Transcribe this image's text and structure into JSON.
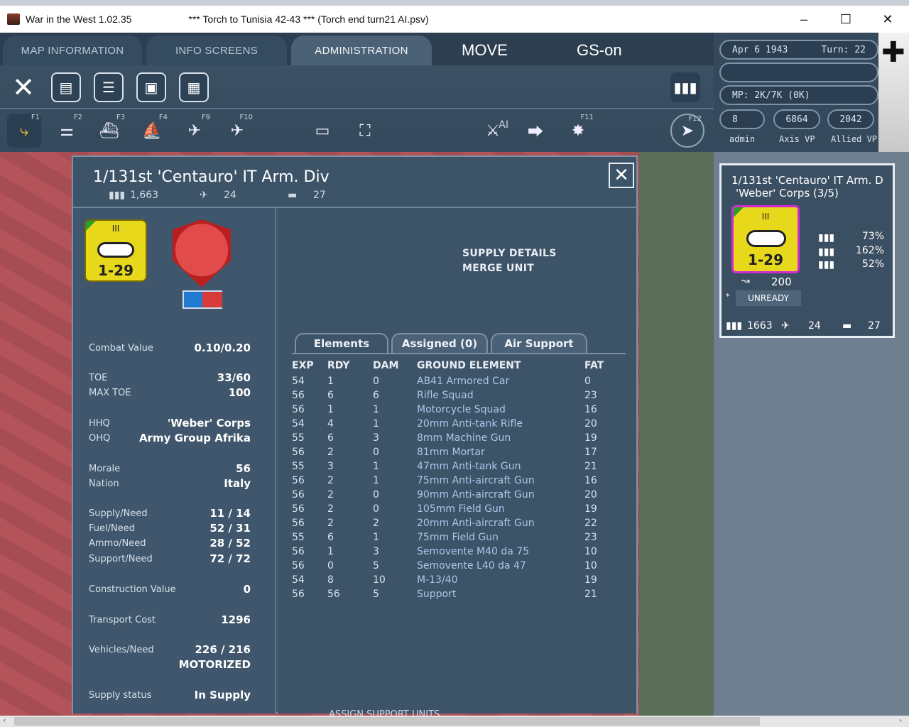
{
  "window": {
    "app_title": "War in the West  1.02.35",
    "scenario": "***   Torch to Tunisia 42-43   ***   (Torch end turn21 AI.psv)"
  },
  "tabs": [
    "MAP INFORMATION",
    "INFO SCREENS",
    "ADMINISTRATION"
  ],
  "mode": {
    "move": "MOVE",
    "gs": "GS-on"
  },
  "fkeys": [
    "F1",
    "F2",
    "F3",
    "F4",
    "F9",
    "F10",
    "F11",
    "F12"
  ],
  "toolbar_ai": "AI",
  "status": {
    "date": "Apr 6 1943",
    "turn": "Turn: 22",
    "mp": "MP:  2K/7K (0K)",
    "admin_val": "8",
    "axis_vp": "6864",
    "allied_vp": "2042",
    "admin_label": "admin",
    "axis_label": "Axis VP",
    "allied_label": "Allied VP"
  },
  "unit": {
    "title": "1/131st 'Centauro' IT Arm. Div",
    "men": "1,663",
    "guns": "24",
    "afv": "27",
    "counter_size": "III",
    "counter_value": "1-29",
    "fields": [
      {
        "label": "Combat Value",
        "value": "0.10/0.20"
      },
      {
        "label": "TOE",
        "value": "33/60"
      },
      {
        "label": "MAX TOE",
        "value": "100"
      },
      {
        "label": "HHQ",
        "value": "'Weber' Corps"
      },
      {
        "label": "OHQ",
        "value": "Army Group Afrika"
      },
      {
        "label": "Morale",
        "value": "56"
      },
      {
        "label": "Nation",
        "value": "Italy"
      },
      {
        "label": "Supply/Need",
        "value": "11 / 14"
      },
      {
        "label": "Fuel/Need",
        "value": "52 / 31"
      },
      {
        "label": "Ammo/Need",
        "value": "28 / 52"
      },
      {
        "label": "Support/Need",
        "value": "72 / 72"
      },
      {
        "label": "Construction Value",
        "value": "0"
      },
      {
        "label": "Transport Cost",
        "value": "1296"
      },
      {
        "label": "Vehicles/Need",
        "value": "226 / 216"
      },
      {
        "label": "",
        "value": "MOTORIZED"
      },
      {
        "label": "Supply status",
        "value": "In Supply"
      }
    ],
    "links": [
      "SUPPLY DETAILS",
      "MERGE UNIT"
    ],
    "subtabs": [
      "Elements",
      "Assigned (0)",
      "Air Support"
    ],
    "headers": [
      "EXP",
      "RDY",
      "DAM",
      "GROUND ELEMENT",
      "FAT"
    ],
    "elements": [
      [
        "54",
        "1",
        "0",
        "AB41 Armored Car",
        "0"
      ],
      [
        "56",
        "6",
        "6",
        "Rifle Squad",
        "23"
      ],
      [
        "56",
        "1",
        "1",
        "Motorcycle Squad",
        "16"
      ],
      [
        "54",
        "4",
        "1",
        "20mm Anti-tank Rifle",
        "20"
      ],
      [
        "55",
        "6",
        "3",
        "8mm Machine Gun",
        "19"
      ],
      [
        "56",
        "2",
        "0",
        "81mm Mortar",
        "17"
      ],
      [
        "55",
        "3",
        "1",
        "47mm Anti-tank Gun",
        "21"
      ],
      [
        "56",
        "2",
        "1",
        "75mm Anti-aircraft Gun",
        "16"
      ],
      [
        "56",
        "2",
        "0",
        "90mm Anti-aircraft Gun",
        "20"
      ],
      [
        "56",
        "2",
        "0",
        "105mm Field Gun",
        "19"
      ],
      [
        "56",
        "2",
        "2",
        "20mm Anti-aircraft Gun",
        "22"
      ],
      [
        "55",
        "6",
        "1",
        "75mm Field Gun",
        "23"
      ],
      [
        "56",
        "1",
        "3",
        "Semovente M40 da 75",
        "10"
      ],
      [
        "56",
        "0",
        "5",
        "Semovente L40 da 47",
        "10"
      ],
      [
        "54",
        "8",
        "10",
        "M-13/40",
        "19"
      ],
      [
        "56",
        "56",
        "5",
        "Support",
        "21"
      ]
    ],
    "assign_support": "ASSIGN SUPPORT UNITS"
  },
  "mini": {
    "title": "1/131st 'Centauro' IT Arm. D",
    "corps": "'Weber' Corps (3/5)",
    "pct1": "73%",
    "pct2": "162%",
    "pct3": "52%",
    "mp": "200",
    "ready": "UNREADY",
    "men": "1663",
    "guns": "24",
    "afv": "27"
  }
}
